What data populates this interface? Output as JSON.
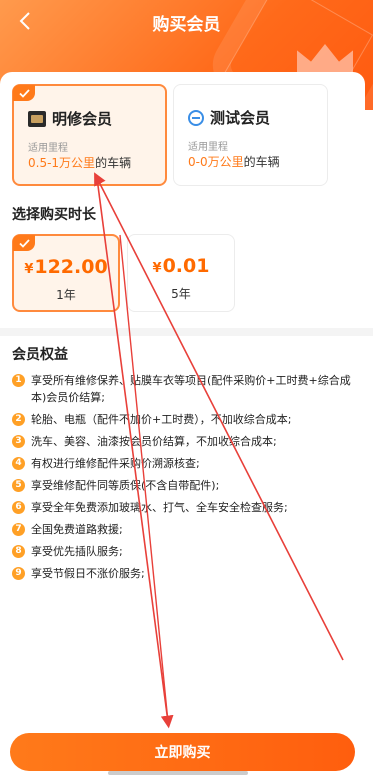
{
  "header": {
    "title": "购买会员"
  },
  "memberships": [
    {
      "name": "明修会员",
      "range_label": "适用里程",
      "range_value": "0.5-1万公里",
      "range_suffix": "的车辆",
      "selected": true
    },
    {
      "name": "测试会员",
      "range_label": "适用里程",
      "range_value": "0-0万公里",
      "range_suffix": "的车辆",
      "selected": false
    }
  ],
  "duration": {
    "title": "选择购买时长",
    "options": [
      {
        "currency": "¥",
        "price": "122.00",
        "period": "1年",
        "selected": true
      },
      {
        "currency": "¥",
        "price": "0.01",
        "period": "5年",
        "selected": false
      }
    ]
  },
  "benefits": {
    "title": "会员权益",
    "items": [
      {
        "num": "1",
        "text": "享受所有维修保养、贴膜车衣等项目(配件采购价+工时费+综合成本)会员价结算;"
      },
      {
        "num": "2",
        "text": "轮胎、电瓶（配件不加价+工时费），不加收综合成本;"
      },
      {
        "num": "3",
        "text": "洗车、美容、油漆按会员价结算，不加收综合成本;"
      },
      {
        "num": "4",
        "text": "有权进行维修配件采购价溯源核查;"
      },
      {
        "num": "5",
        "text": "享受维修配件同等质保(不含自带配件);"
      },
      {
        "num": "6",
        "text": "享受全年免费添加玻璃水、打气、全车安全检查服务;"
      },
      {
        "num": "7",
        "text": "全国免费道路救援;"
      },
      {
        "num": "8",
        "text": "享受优先插队服务;"
      },
      {
        "num": "9",
        "text": "享受节假日不涨价服务;"
      }
    ]
  },
  "footer": {
    "buy_label": "立即购买"
  },
  "colors": {
    "accent": "#ff6a1a",
    "price": "#ff6a00",
    "selected_bg": "#fff4ea",
    "annotation": "#e8403a"
  }
}
